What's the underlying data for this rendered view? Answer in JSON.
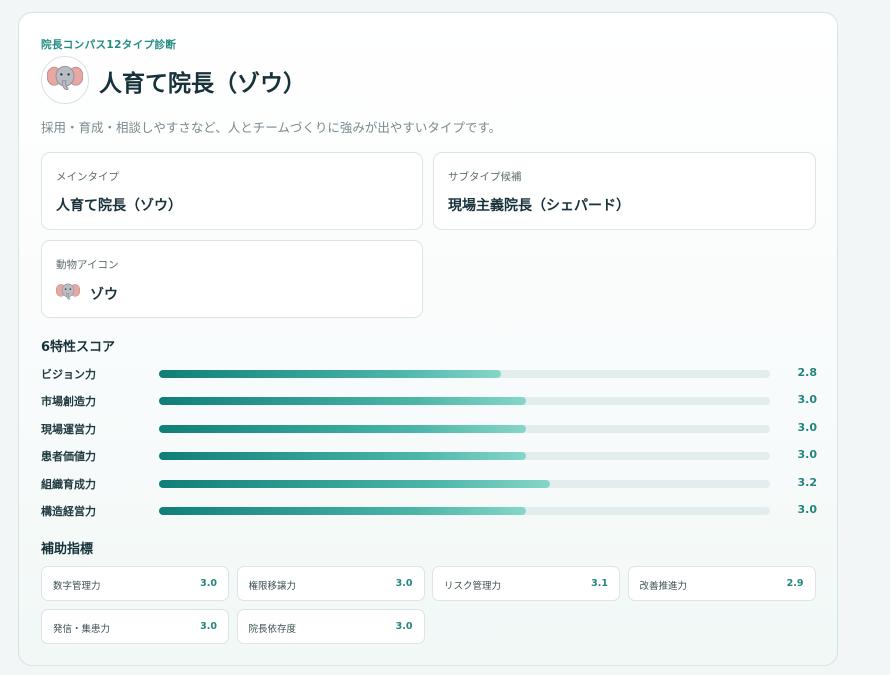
{
  "header": {
    "eyebrow": "院長コンパス12タイプ診断",
    "title": "人育て院長（ゾウ）",
    "description": "採用・育成・相談しやすさなど、人とチームづくりに強みが出やすいタイプです。",
    "avatar_icon": "elephant-icon"
  },
  "info": {
    "main_type": {
      "label": "メインタイプ",
      "value": "人育て院長（ゾウ）"
    },
    "sub_type": {
      "label": "サブタイプ候補",
      "value": "現場主義院長（シェパード）"
    },
    "animal": {
      "label": "動物アイコン",
      "value": "ゾウ",
      "icon": "elephant-icon"
    }
  },
  "scores": {
    "title": "6特性スコア",
    "max": 5,
    "items": [
      {
        "label": "ビジョン力",
        "value": "2.8",
        "fraction": 0.56
      },
      {
        "label": "市場創造力",
        "value": "3.0",
        "fraction": 0.6
      },
      {
        "label": "現場運営力",
        "value": "3.0",
        "fraction": 0.6
      },
      {
        "label": "患者価値力",
        "value": "3.0",
        "fraction": 0.6
      },
      {
        "label": "組織育成力",
        "value": "3.2",
        "fraction": 0.64
      },
      {
        "label": "構造経営力",
        "value": "3.0",
        "fraction": 0.6
      }
    ]
  },
  "metrics": {
    "title": "補助指標",
    "items": [
      {
        "label": "数字管理力",
        "value": "3.0"
      },
      {
        "label": "権限移譲力",
        "value": "3.0"
      },
      {
        "label": "リスク管理力",
        "value": "3.1"
      },
      {
        "label": "改善推進力",
        "value": "2.9"
      },
      {
        "label": "発信・集患力",
        "value": "3.0"
      },
      {
        "label": "院長依存度",
        "value": "3.0"
      }
    ]
  },
  "colors": {
    "accent": "#238b84",
    "bar_start": "#0f7f77",
    "bar_end": "#86d6c8",
    "track": "#e4eded"
  }
}
